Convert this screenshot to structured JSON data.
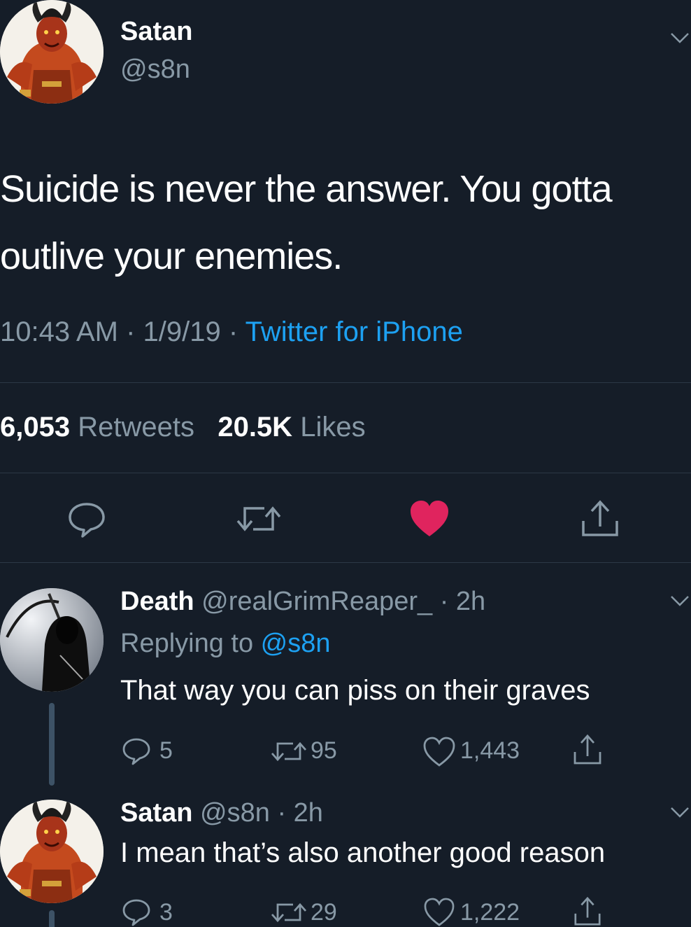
{
  "main_tweet": {
    "author_name": "Satan",
    "author_handle": "@s8n",
    "text": "Suicide is never the answer. You gotta outlive your enemies.",
    "time": "10:43 AM · 1/9/19 · ",
    "source": "Twitter for iPhone",
    "retweets_count": "6,053",
    "retweets_label": "Retweets",
    "likes_count": "20.5K",
    "likes_label": "Likes",
    "liked": true,
    "like_color": "#e0245e"
  },
  "replies": [
    {
      "author_name": "Death",
      "meta": "@realGrimReaper_ · 2h",
      "replying_prefix": "Replying to ",
      "replying_to": "@s8n",
      "text": "That way you can piss on their graves",
      "reply_count": "5",
      "retweet_count": "95",
      "like_count": "1,443"
    },
    {
      "author_name": "Satan",
      "meta": "@s8n · 2h",
      "text": "I mean that’s also another good reason",
      "reply_count": "3",
      "retweet_count": "29",
      "like_count": "1,222"
    }
  ],
  "colors": {
    "background": "#151d28",
    "muted": "#8899a6",
    "link": "#1da1f2",
    "divider": "#2c3846"
  }
}
